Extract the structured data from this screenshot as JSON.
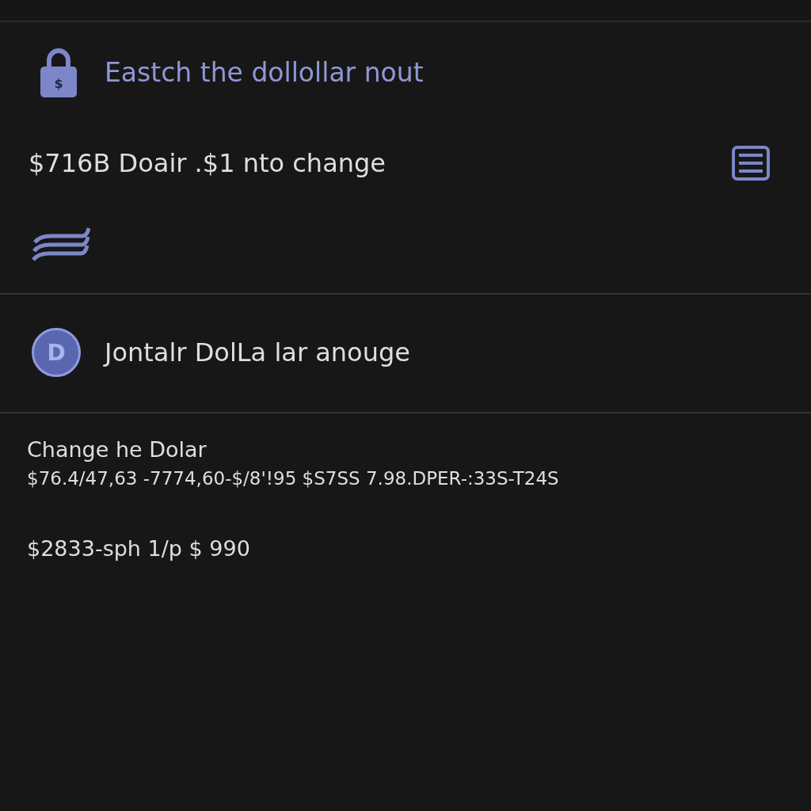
{
  "header": {
    "lock_symbol": "$",
    "title": "Eastch the dollollar nout"
  },
  "summary": {
    "text": "$716B Doair .$1 nto change"
  },
  "account": {
    "avatar": "D",
    "name": "Jontalr DolLa lar anouge"
  },
  "details": {
    "title": "Change he Dolar",
    "line": "$76.4/47,63 -7774,60-$/8'!95 $S7SS 7.98.DPER-:33S-T24S",
    "amount": "$2833-sph 1/p $ 990"
  }
}
